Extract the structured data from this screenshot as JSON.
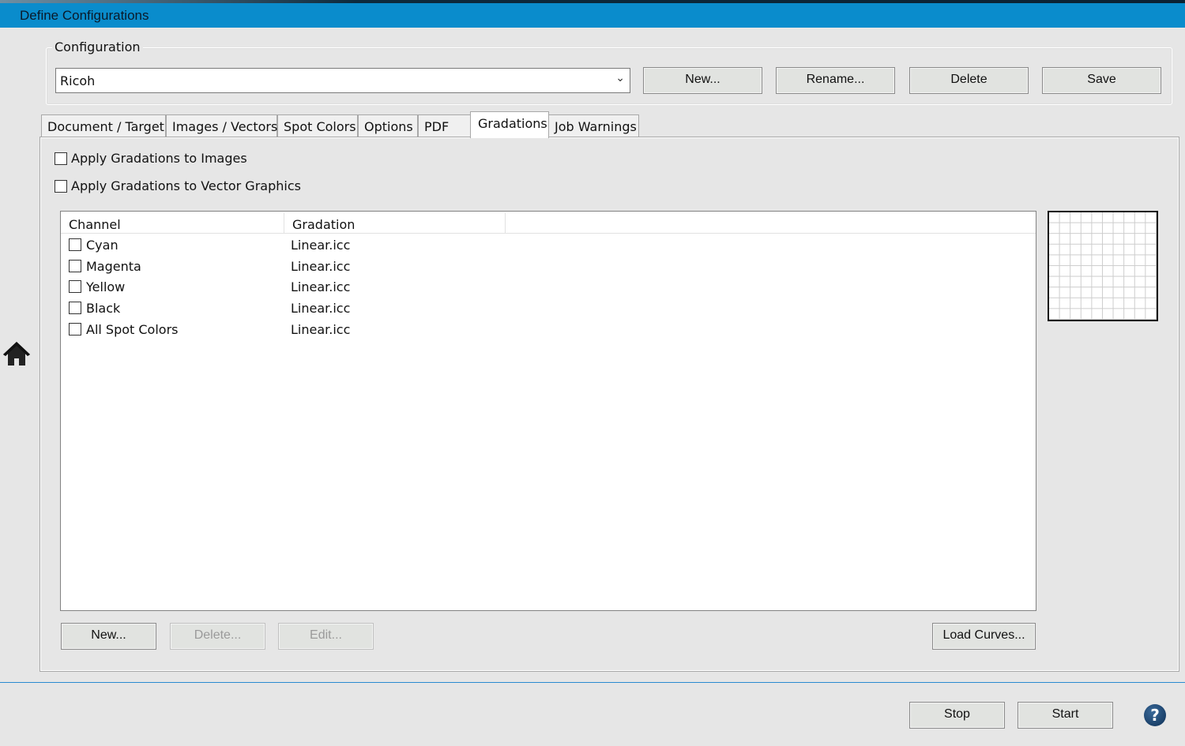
{
  "window": {
    "title": "Define Configurations"
  },
  "configuration": {
    "label": "Configuration",
    "value": "Ricoh",
    "buttons": {
      "new": "New...",
      "rename": "Rename...",
      "delete": "Delete",
      "save": "Save"
    }
  },
  "tabs": [
    {
      "label": "Document / Target"
    },
    {
      "label": "Images / Vectors"
    },
    {
      "label": "Spot Colors"
    },
    {
      "label": "Options"
    },
    {
      "label": "PDF"
    },
    {
      "label": "Gradations",
      "active": true
    },
    {
      "label": "Job Warnings"
    }
  ],
  "gradations": {
    "apply_images": {
      "label": "Apply Gradations to Images",
      "checked": false
    },
    "apply_vectors": {
      "label": "Apply Gradations to Vector Graphics",
      "checked": false
    },
    "columns": [
      "Channel",
      "Gradation"
    ],
    "rows": [
      {
        "channel": "Cyan",
        "gradation": "Linear.icc"
      },
      {
        "channel": "Magenta",
        "gradation": "Linear.icc"
      },
      {
        "channel": "Yellow",
        "gradation": "Linear.icc"
      },
      {
        "channel": "Black",
        "gradation": "Linear.icc"
      },
      {
        "channel": "All Spot Colors",
        "gradation": "Linear.icc"
      }
    ],
    "buttons": {
      "new": "New...",
      "delete": "Delete...",
      "edit": "Edit...",
      "load_curves": "Load Curves..."
    }
  },
  "footer": {
    "stop": "Stop",
    "start": "Start",
    "help": "?"
  }
}
